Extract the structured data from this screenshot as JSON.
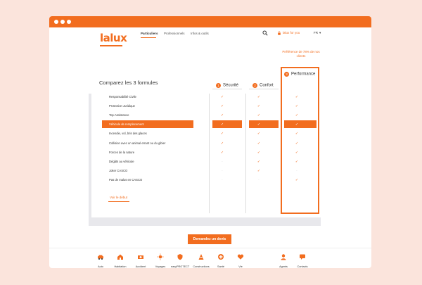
{
  "nav": {
    "logo": "lalux",
    "items": [
      "Particuliers",
      "Professionnels",
      "Infos & outils"
    ],
    "lux_for_you": "lalux for you",
    "lang": "FR",
    "lang_chevron": "▾"
  },
  "comparison": {
    "title": "Comparez les 3 formules",
    "preference_note": "Préférence de 78% de nos clients",
    "columns": [
      {
        "num": "1",
        "label": "Sécurité"
      },
      {
        "num": "2",
        "label": "Confort"
      },
      {
        "num": "3",
        "label": "Performance"
      }
    ],
    "rows": [
      {
        "label": "Responsabilité Civile",
        "values": [
          true,
          true,
          true
        ]
      },
      {
        "label": "Protection Juridique",
        "values": [
          true,
          true,
          true
        ]
      },
      {
        "label": "Top-Assistance",
        "values": [
          true,
          true,
          true
        ]
      },
      {
        "label": "Véhicule de remplacement",
        "values": [
          true,
          true,
          true
        ],
        "highlight": true
      },
      {
        "label": "Incendie, vol, bris des glaces",
        "values": [
          true,
          true,
          true
        ]
      },
      {
        "label": "Collision avec un animal errant ou du gibier",
        "values": [
          true,
          true,
          true
        ]
      },
      {
        "label": "Forces de la nature",
        "values": [
          true,
          true,
          true
        ]
      },
      {
        "label": "Dégâts au véhicule",
        "values": [
          false,
          true,
          true
        ]
      },
      {
        "label": "Joker CASCO",
        "values": [
          false,
          true,
          false
        ]
      },
      {
        "label": "Pas de malus en CASCO",
        "values": [
          false,
          false,
          true
        ]
      }
    ],
    "back_link": "Voir le début",
    "cta": "Demandez un devis"
  },
  "footer": {
    "items": [
      {
        "label": "Auto",
        "icon": "car-icon"
      },
      {
        "label": "Habitation",
        "icon": "house-icon"
      },
      {
        "label": "Accident",
        "icon": "ambulance-icon"
      },
      {
        "label": "Voyages",
        "icon": "sun-icon"
      },
      {
        "label": "easyPROTECT",
        "icon": "shield-icon"
      },
      {
        "label": "Constructions",
        "icon": "cone-icon"
      },
      {
        "label": "Santé",
        "icon": "health-icon"
      },
      {
        "label": "Vie",
        "icon": "heart-icon"
      },
      {
        "label": "Agents",
        "icon": "agent-icon"
      },
      {
        "label": "Contacts",
        "icon": "chat-icon"
      }
    ]
  },
  "colors": {
    "accent": "#f26d1f",
    "background": "#fbe4dc"
  }
}
